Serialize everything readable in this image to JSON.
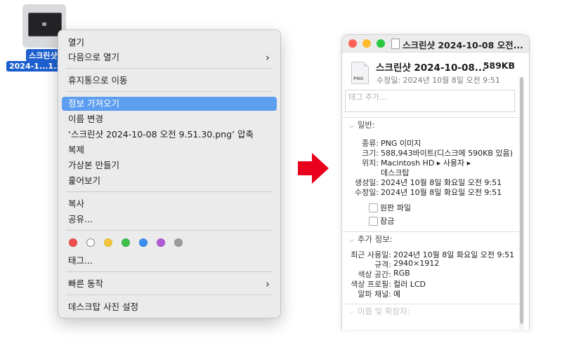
{
  "desktop_file": {
    "label_line1": "스크린샷",
    "label_line2": "2024-1...1.30"
  },
  "context_menu": {
    "items": [
      {
        "label": "열기"
      },
      {
        "label": "다음으로 열기",
        "submenu": true
      },
      {
        "label": "휴지통으로 이동"
      },
      {
        "label": "정보 가져오기",
        "highlighted": true
      },
      {
        "label": "이름 변경"
      },
      {
        "label": "‘스크린샷 2024-10-08 오전 9.51.30.png’ 압축"
      },
      {
        "label": "복제"
      },
      {
        "label": "가상본 만들기"
      },
      {
        "label": "훑어보기"
      },
      {
        "label": "복사"
      },
      {
        "label": "공유..."
      },
      {
        "label": "태그..."
      },
      {
        "label": "빠른 동작",
        "submenu": true
      },
      {
        "label": "데스크탑 사진 설정"
      }
    ],
    "tag_colors": [
      "#ee4d4d",
      "#ffffff",
      "#f5c63a",
      "#3cc14b",
      "#3a8ef0",
      "#b05ad6",
      "#9b9b9b"
    ],
    "submenu_icon": "chevron-right-icon"
  },
  "arrow": {
    "icon": "red-arrow-right-icon",
    "color": "#e8001c"
  },
  "info_window": {
    "title": "스크린샷 2024-10-08 오전...",
    "file_name": "스크린샷 2024-10-08...",
    "file_size": "589KB",
    "modified": "수정일: 2024년 10월 8일 오전 9:51",
    "tag_placeholder": "태그 추가...",
    "file_type_badge": "PNG",
    "general": {
      "title": "일반:",
      "rows": [
        {
          "key": "종류:",
          "value": "PNG 이미지"
        },
        {
          "key": "크기:",
          "value": "588,943바이트(디스크에 590KB 있음)"
        },
        {
          "key": "위치:",
          "value": "Macintosh HD ▸ 사용자 ▸"
        },
        {
          "key": "",
          "value": "데스크탑"
        },
        {
          "key": "생성일:",
          "value": "2024년 10월 8일 화요일 오전 9:51"
        },
        {
          "key": "수정일:",
          "value": "2024년 10월 8일 화요일 오전 9:51"
        }
      ],
      "checkboxes": [
        {
          "label": "원판 파일",
          "checked": false
        },
        {
          "label": "잠금",
          "checked": false
        }
      ]
    },
    "more_info": {
      "title": "추가 정보:",
      "rows": [
        {
          "key": "최근 사용일:",
          "value": "2024년 10월 8일 화요일 오전 9:51"
        },
        {
          "key": "규격:",
          "value": "2940×1912"
        },
        {
          "key": "색상 공간:",
          "value": "RGB"
        },
        {
          "key": "색상 프로필:",
          "value": "컬러 LCD"
        },
        {
          "key": "알파 채널:",
          "value": "예"
        }
      ]
    },
    "name_ext_title": "이름 및 확장자:"
  }
}
